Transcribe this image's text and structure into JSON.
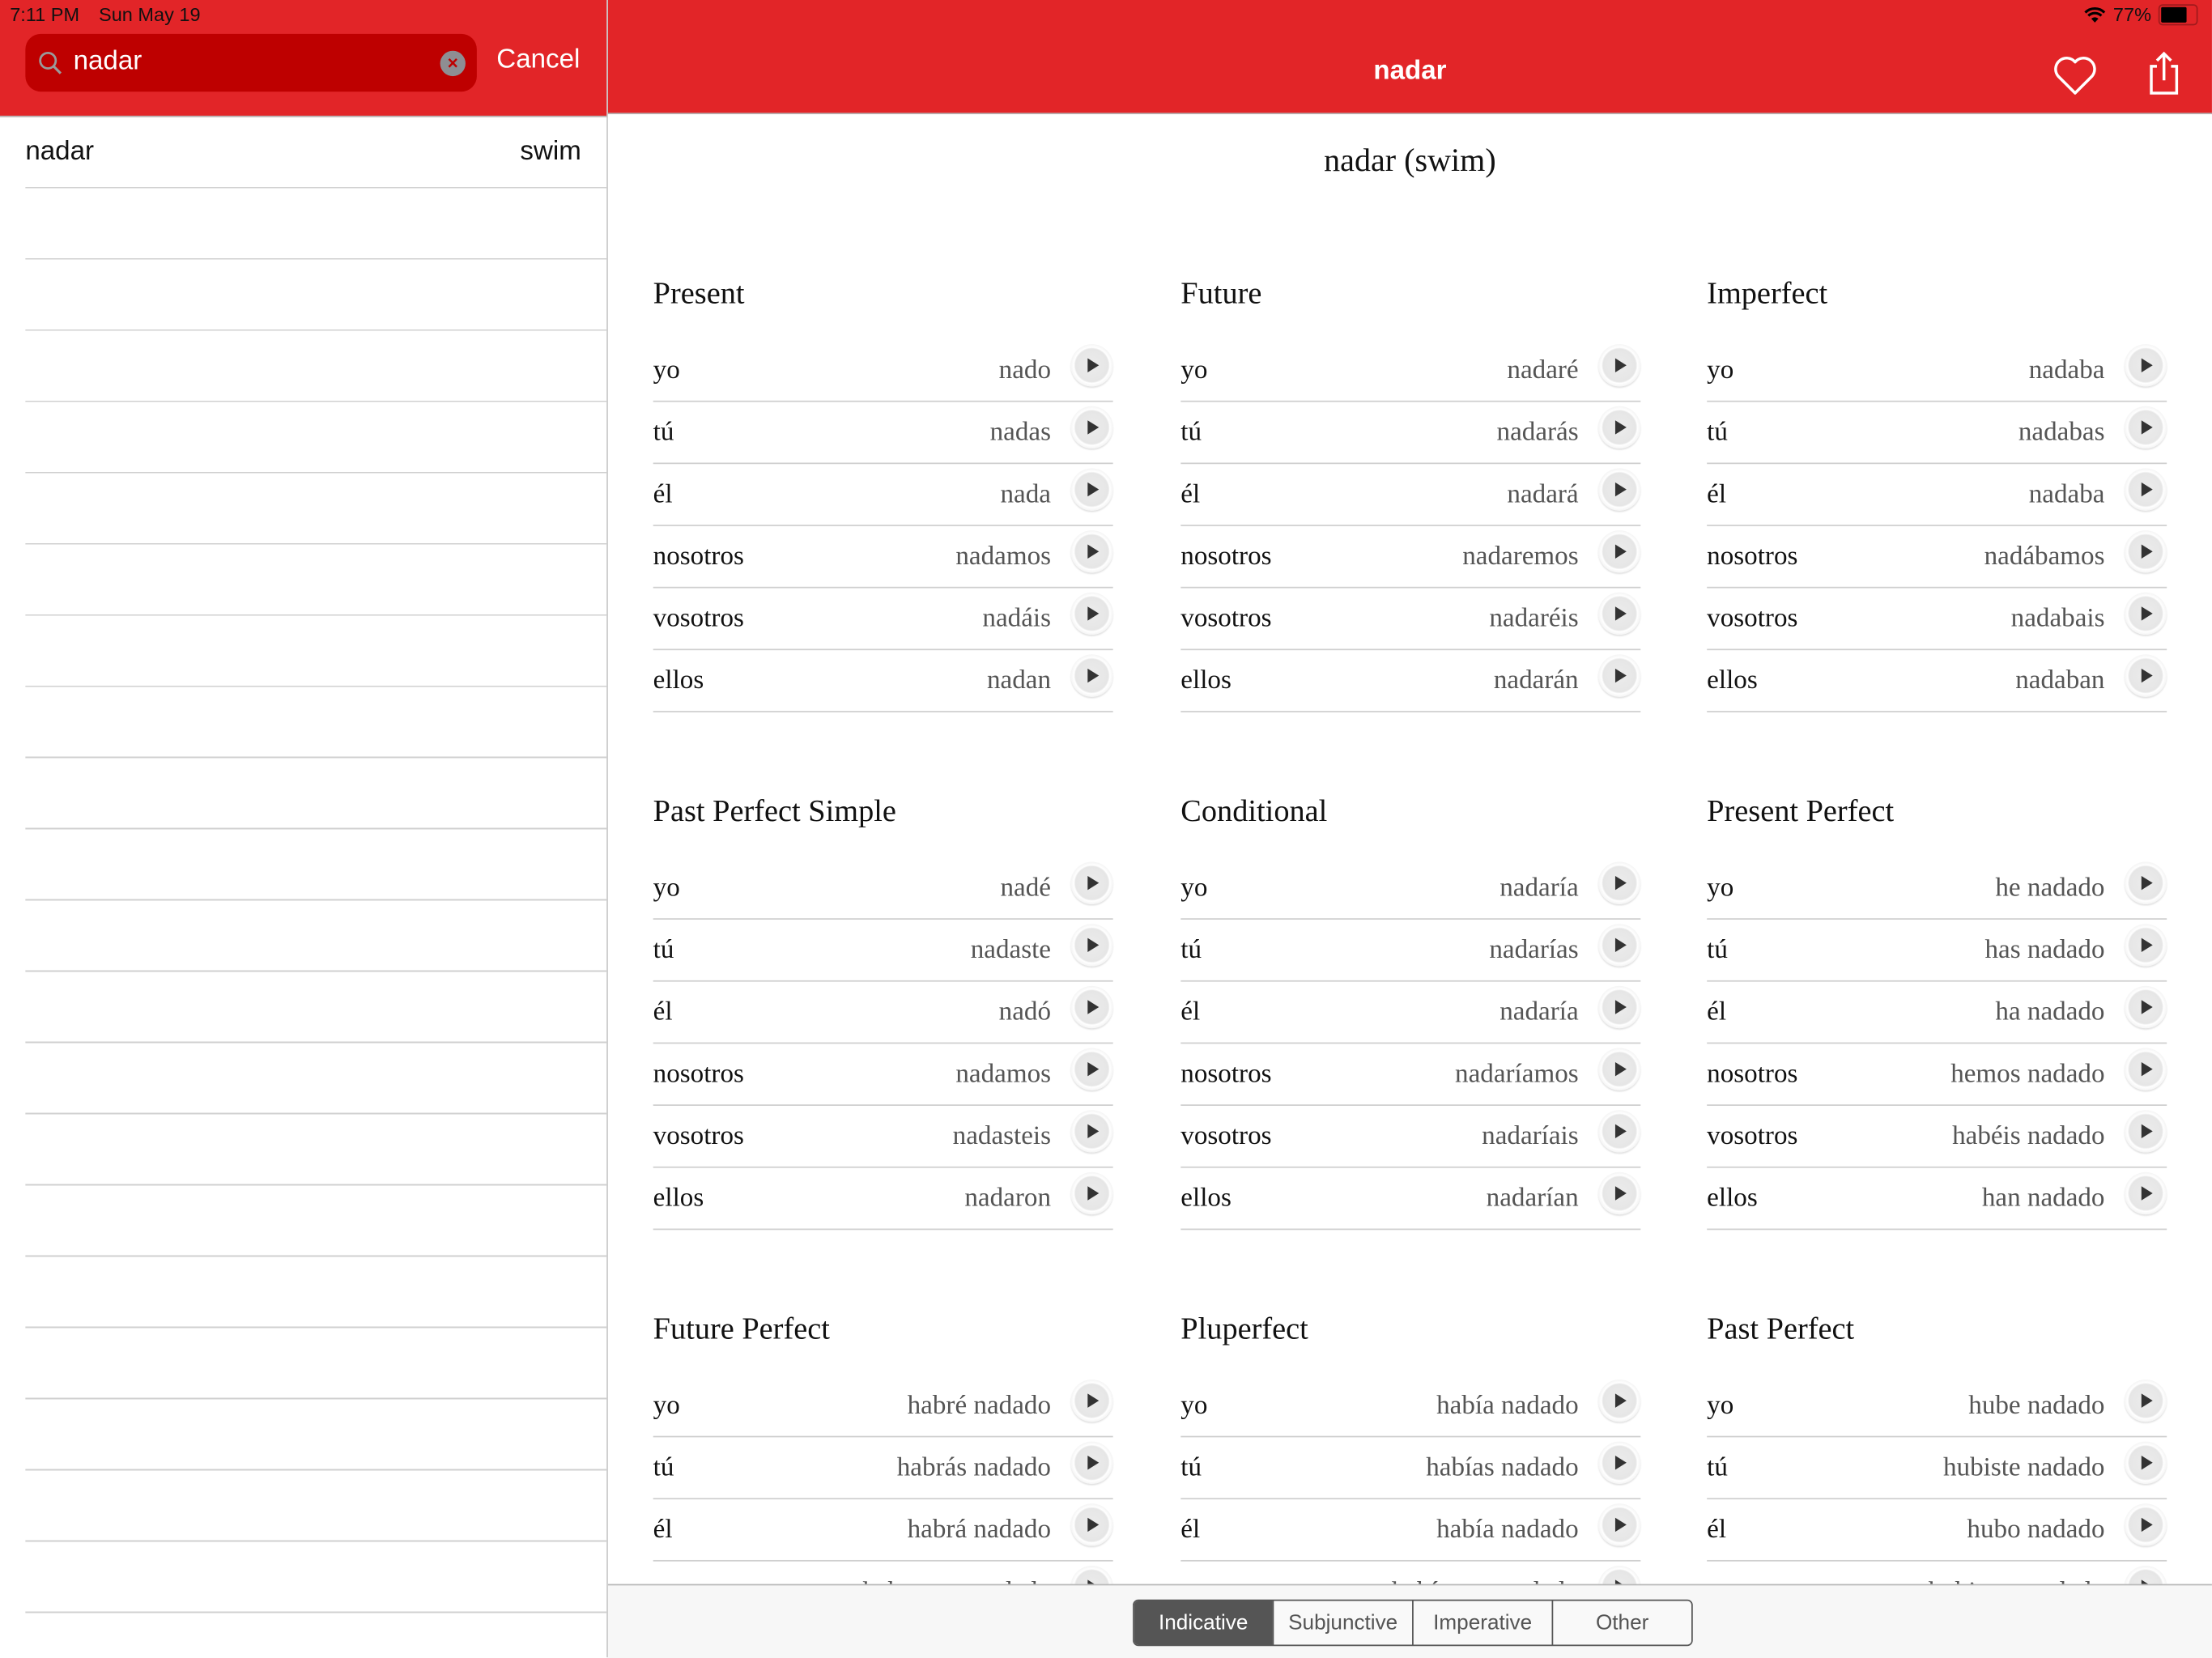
{
  "status": {
    "time": "7:11 PM",
    "date": "Sun May 19",
    "battery": "77%",
    "battery_level": 0.77
  },
  "colors": {
    "brand_red": "#e22528",
    "search_bg": "#be0000",
    "segment_active": "#555555"
  },
  "search": {
    "value": "nadar",
    "cancel_label": "Cancel"
  },
  "results": [
    {
      "word": "nadar",
      "translation": "swim"
    }
  ],
  "nav": {
    "title": "nadar",
    "favorite_icon": "heart-icon",
    "share_icon": "share-icon"
  },
  "verb_title": "nadar (swim)",
  "tenses": [
    {
      "name": "Present",
      "forms": [
        [
          "yo",
          "nado"
        ],
        [
          "tú",
          "nadas"
        ],
        [
          "él",
          "nada"
        ],
        [
          "nosotros",
          "nadamos"
        ],
        [
          "vosotros",
          "nadáis"
        ],
        [
          "ellos",
          "nadan"
        ]
      ]
    },
    {
      "name": "Future",
      "forms": [
        [
          "yo",
          "nadaré"
        ],
        [
          "tú",
          "nadarás"
        ],
        [
          "él",
          "nadará"
        ],
        [
          "nosotros",
          "nadaremos"
        ],
        [
          "vosotros",
          "nadaréis"
        ],
        [
          "ellos",
          "nadarán"
        ]
      ]
    },
    {
      "name": "Imperfect",
      "forms": [
        [
          "yo",
          "nadaba"
        ],
        [
          "tú",
          "nadabas"
        ],
        [
          "él",
          "nadaba"
        ],
        [
          "nosotros",
          "nadábamos"
        ],
        [
          "vosotros",
          "nadabais"
        ],
        [
          "ellos",
          "nadaban"
        ]
      ]
    },
    {
      "name": "Past Perfect Simple",
      "forms": [
        [
          "yo",
          "nadé"
        ],
        [
          "tú",
          "nadaste"
        ],
        [
          "él",
          "nadó"
        ],
        [
          "nosotros",
          "nadamos"
        ],
        [
          "vosotros",
          "nadasteis"
        ],
        [
          "ellos",
          "nadaron"
        ]
      ]
    },
    {
      "name": "Conditional",
      "forms": [
        [
          "yo",
          "nadaría"
        ],
        [
          "tú",
          "nadarías"
        ],
        [
          "él",
          "nadaría"
        ],
        [
          "nosotros",
          "nadaríamos"
        ],
        [
          "vosotros",
          "nadaríais"
        ],
        [
          "ellos",
          "nadarían"
        ]
      ]
    },
    {
      "name": "Present Perfect",
      "forms": [
        [
          "yo",
          "he nadado"
        ],
        [
          "tú",
          "has nadado"
        ],
        [
          "él",
          "ha nadado"
        ],
        [
          "nosotros",
          "hemos nadado"
        ],
        [
          "vosotros",
          "habéis nadado"
        ],
        [
          "ellos",
          "han nadado"
        ]
      ]
    },
    {
      "name": "Future Perfect",
      "forms": [
        [
          "yo",
          "habré nadado"
        ],
        [
          "tú",
          "habrás nadado"
        ],
        [
          "él",
          "habrá nadado"
        ],
        [
          "nosotros",
          "habremos nadado"
        ]
      ]
    },
    {
      "name": "Pluperfect",
      "forms": [
        [
          "yo",
          "había nadado"
        ],
        [
          "tú",
          "habías nadado"
        ],
        [
          "él",
          "había nadado"
        ],
        [
          "nosotros",
          "habíamos nadado"
        ]
      ]
    },
    {
      "name": "Past Perfect",
      "forms": [
        [
          "yo",
          "hube nadado"
        ],
        [
          "tú",
          "hubiste nadado"
        ],
        [
          "él",
          "hubo nadado"
        ],
        [
          "nosotros",
          "hubimos nadado"
        ]
      ]
    }
  ],
  "moods": [
    {
      "label": "Indicative",
      "active": true
    },
    {
      "label": "Subjunctive",
      "active": false
    },
    {
      "label": "Imperative",
      "active": false
    },
    {
      "label": "Other",
      "active": false
    }
  ]
}
